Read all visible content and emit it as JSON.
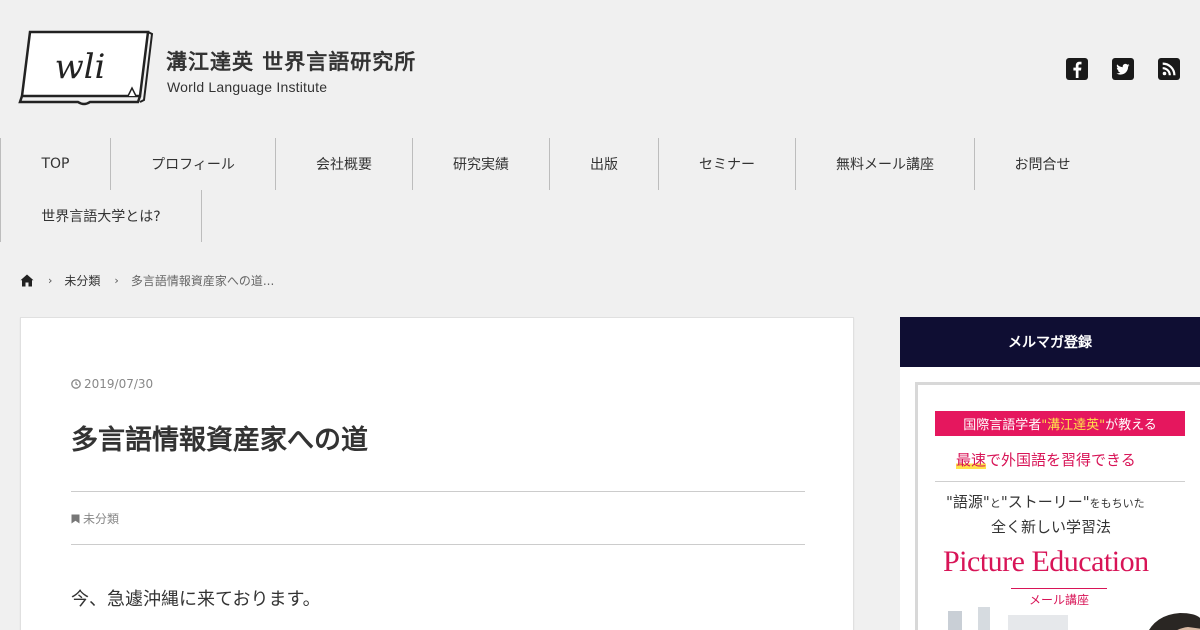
{
  "site": {
    "logo_mark": "wli",
    "title": "溝江達英 世界言語研究所",
    "subtitle": "World Language Institute"
  },
  "social": [
    {
      "name": "facebook",
      "icon": "facebook-icon"
    },
    {
      "name": "twitter",
      "icon": "twitter-icon"
    },
    {
      "name": "rss",
      "icon": "rss-icon"
    }
  ],
  "nav": {
    "items": [
      "TOP",
      "プロフィール",
      "会社概要",
      "研究実績",
      "出版",
      "セミナー",
      "無料メール講座",
      "お問合せ",
      "世界言語大学とは?"
    ]
  },
  "breadcrumb": {
    "home_icon": "home-icon",
    "category": "未分類",
    "current": "多言語情報資産家への道..."
  },
  "post": {
    "date": "2019/07/30",
    "title": "多言語情報資産家への道",
    "category": "未分類",
    "body_first_line": "今、急遽沖縄に来ております。"
  },
  "sidebar": {
    "heading": "メルマガ登録",
    "banner": {
      "line1_pre": "国際言語学者",
      "line1_name": "\"溝江達英\"",
      "line1_post": "が教える",
      "line2_em": "最速",
      "line2_rest": "で外国語を習得できる",
      "line3_a": "\"語源\"",
      "line3_small1": "と",
      "line3_b": "\"ストーリー\"",
      "line3_small2": "をもちいた",
      "line4": "全く新しい学習法",
      "headline": "Picture Education",
      "tag": "メール講座"
    }
  },
  "colors": {
    "background": "#f0f0f0",
    "sidebar_heading_bg": "#0f0e33",
    "banner_accent": "#d81457",
    "banner_red_bar": "#e5175e",
    "highlight_yellow": "#ffe14a"
  }
}
